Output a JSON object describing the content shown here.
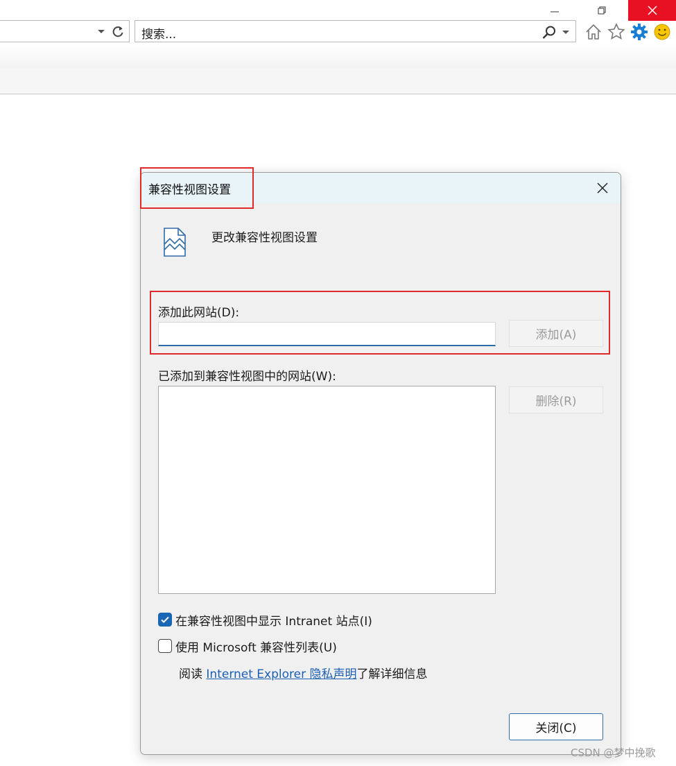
{
  "browser": {
    "search": {
      "text": "搜索..."
    }
  },
  "dialog": {
    "title": "兼容性视图设置",
    "heading": "更改兼容性视图设置",
    "add_site_label": "添加此网站(D):",
    "add_site_value": "",
    "add_button": "添加(A)",
    "sites_list_label": "已添加到兼容性视图中的网站(W):",
    "sites": [],
    "remove_button": "删除(R)",
    "checkbox_intranet": {
      "label": "在兼容性视图中显示 Intranet 站点(I)",
      "checked": true
    },
    "checkbox_mslist": {
      "label": "使用 Microsoft 兼容性列表(U)",
      "checked": false
    },
    "privacy": {
      "prefix": "阅读 ",
      "link": "Internet Explorer 隐私声明",
      "suffix": "了解详细信息"
    },
    "close_button": "关闭(C)"
  },
  "watermark": "CSDN @梦中挽歌",
  "colors": {
    "accent": "#1866b4",
    "close_hover": "#e81123",
    "highlight": "#e2292a",
    "link": "#1a5fb4",
    "gear": "#1a7fd4"
  }
}
